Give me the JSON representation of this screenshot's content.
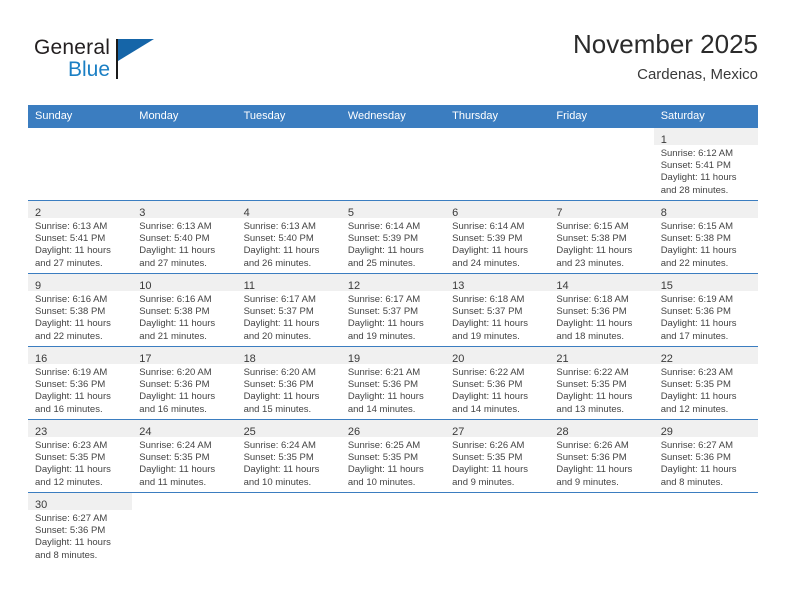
{
  "brand": {
    "name_top": "General",
    "name_bottom": "Blue",
    "accent_color": "#1565a8",
    "text_color": "#231f20"
  },
  "header": {
    "title": "November 2025",
    "subtitle": "Cardenas, Mexico"
  },
  "theme": {
    "header_bar_color": "#3b7dc0",
    "daynum_band_color": "#f0f0f0",
    "row_divider_color": "#3b7dc0",
    "body_text_color": "#444444"
  },
  "calendar": {
    "weekday_headers": [
      "Sunday",
      "Monday",
      "Tuesday",
      "Wednesday",
      "Thursday",
      "Friday",
      "Saturday"
    ],
    "weeks": [
      [
        {
          "day": "",
          "lines": []
        },
        {
          "day": "",
          "lines": []
        },
        {
          "day": "",
          "lines": []
        },
        {
          "day": "",
          "lines": []
        },
        {
          "day": "",
          "lines": []
        },
        {
          "day": "",
          "lines": []
        },
        {
          "day": "1",
          "lines": [
            "Sunrise: 6:12 AM",
            "Sunset: 5:41 PM",
            "Daylight: 11 hours",
            "and 28 minutes."
          ]
        }
      ],
      [
        {
          "day": "2",
          "lines": [
            "Sunrise: 6:13 AM",
            "Sunset: 5:41 PM",
            "Daylight: 11 hours",
            "and 27 minutes."
          ]
        },
        {
          "day": "3",
          "lines": [
            "Sunrise: 6:13 AM",
            "Sunset: 5:40 PM",
            "Daylight: 11 hours",
            "and 27 minutes."
          ]
        },
        {
          "day": "4",
          "lines": [
            "Sunrise: 6:13 AM",
            "Sunset: 5:40 PM",
            "Daylight: 11 hours",
            "and 26 minutes."
          ]
        },
        {
          "day": "5",
          "lines": [
            "Sunrise: 6:14 AM",
            "Sunset: 5:39 PM",
            "Daylight: 11 hours",
            "and 25 minutes."
          ]
        },
        {
          "day": "6",
          "lines": [
            "Sunrise: 6:14 AM",
            "Sunset: 5:39 PM",
            "Daylight: 11 hours",
            "and 24 minutes."
          ]
        },
        {
          "day": "7",
          "lines": [
            "Sunrise: 6:15 AM",
            "Sunset: 5:38 PM",
            "Daylight: 11 hours",
            "and 23 minutes."
          ]
        },
        {
          "day": "8",
          "lines": [
            "Sunrise: 6:15 AM",
            "Sunset: 5:38 PM",
            "Daylight: 11 hours",
            "and 22 minutes."
          ]
        }
      ],
      [
        {
          "day": "9",
          "lines": [
            "Sunrise: 6:16 AM",
            "Sunset: 5:38 PM",
            "Daylight: 11 hours",
            "and 22 minutes."
          ]
        },
        {
          "day": "10",
          "lines": [
            "Sunrise: 6:16 AM",
            "Sunset: 5:38 PM",
            "Daylight: 11 hours",
            "and 21 minutes."
          ]
        },
        {
          "day": "11",
          "lines": [
            "Sunrise: 6:17 AM",
            "Sunset: 5:37 PM",
            "Daylight: 11 hours",
            "and 20 minutes."
          ]
        },
        {
          "day": "12",
          "lines": [
            "Sunrise: 6:17 AM",
            "Sunset: 5:37 PM",
            "Daylight: 11 hours",
            "and 19 minutes."
          ]
        },
        {
          "day": "13",
          "lines": [
            "Sunrise: 6:18 AM",
            "Sunset: 5:37 PM",
            "Daylight: 11 hours",
            "and 19 minutes."
          ]
        },
        {
          "day": "14",
          "lines": [
            "Sunrise: 6:18 AM",
            "Sunset: 5:36 PM",
            "Daylight: 11 hours",
            "and 18 minutes."
          ]
        },
        {
          "day": "15",
          "lines": [
            "Sunrise: 6:19 AM",
            "Sunset: 5:36 PM",
            "Daylight: 11 hours",
            "and 17 minutes."
          ]
        }
      ],
      [
        {
          "day": "16",
          "lines": [
            "Sunrise: 6:19 AM",
            "Sunset: 5:36 PM",
            "Daylight: 11 hours",
            "and 16 minutes."
          ]
        },
        {
          "day": "17",
          "lines": [
            "Sunrise: 6:20 AM",
            "Sunset: 5:36 PM",
            "Daylight: 11 hours",
            "and 16 minutes."
          ]
        },
        {
          "day": "18",
          "lines": [
            "Sunrise: 6:20 AM",
            "Sunset: 5:36 PM",
            "Daylight: 11 hours",
            "and 15 minutes."
          ]
        },
        {
          "day": "19",
          "lines": [
            "Sunrise: 6:21 AM",
            "Sunset: 5:36 PM",
            "Daylight: 11 hours",
            "and 14 minutes."
          ]
        },
        {
          "day": "20",
          "lines": [
            "Sunrise: 6:22 AM",
            "Sunset: 5:36 PM",
            "Daylight: 11 hours",
            "and 14 minutes."
          ]
        },
        {
          "day": "21",
          "lines": [
            "Sunrise: 6:22 AM",
            "Sunset: 5:35 PM",
            "Daylight: 11 hours",
            "and 13 minutes."
          ]
        },
        {
          "day": "22",
          "lines": [
            "Sunrise: 6:23 AM",
            "Sunset: 5:35 PM",
            "Daylight: 11 hours",
            "and 12 minutes."
          ]
        }
      ],
      [
        {
          "day": "23",
          "lines": [
            "Sunrise: 6:23 AM",
            "Sunset: 5:35 PM",
            "Daylight: 11 hours",
            "and 12 minutes."
          ]
        },
        {
          "day": "24",
          "lines": [
            "Sunrise: 6:24 AM",
            "Sunset: 5:35 PM",
            "Daylight: 11 hours",
            "and 11 minutes."
          ]
        },
        {
          "day": "25",
          "lines": [
            "Sunrise: 6:24 AM",
            "Sunset: 5:35 PM",
            "Daylight: 11 hours",
            "and 10 minutes."
          ]
        },
        {
          "day": "26",
          "lines": [
            "Sunrise: 6:25 AM",
            "Sunset: 5:35 PM",
            "Daylight: 11 hours",
            "and 10 minutes."
          ]
        },
        {
          "day": "27",
          "lines": [
            "Sunrise: 6:26 AM",
            "Sunset: 5:35 PM",
            "Daylight: 11 hours",
            "and 9 minutes."
          ]
        },
        {
          "day": "28",
          "lines": [
            "Sunrise: 6:26 AM",
            "Sunset: 5:36 PM",
            "Daylight: 11 hours",
            "and 9 minutes."
          ]
        },
        {
          "day": "29",
          "lines": [
            "Sunrise: 6:27 AM",
            "Sunset: 5:36 PM",
            "Daylight: 11 hours",
            "and 8 minutes."
          ]
        }
      ],
      [
        {
          "day": "30",
          "lines": [
            "Sunrise: 6:27 AM",
            "Sunset: 5:36 PM",
            "Daylight: 11 hours",
            "and 8 minutes."
          ]
        },
        {
          "day": "",
          "lines": []
        },
        {
          "day": "",
          "lines": []
        },
        {
          "day": "",
          "lines": []
        },
        {
          "day": "",
          "lines": []
        },
        {
          "day": "",
          "lines": []
        },
        {
          "day": "",
          "lines": []
        }
      ]
    ]
  }
}
